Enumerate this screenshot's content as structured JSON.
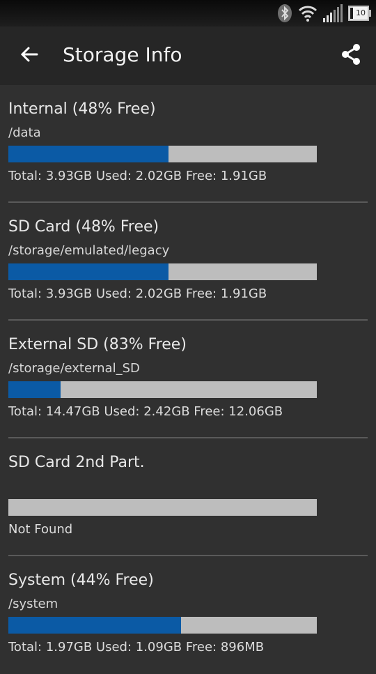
{
  "status_bar": {
    "battery_level": "10",
    "icons": [
      "bluetooth-icon",
      "wifi-icon",
      "signal-icon",
      "battery-icon"
    ]
  },
  "app_bar": {
    "title": "Storage Info",
    "back_icon": "arrow-left-icon",
    "share_icon": "share-icon"
  },
  "colors": {
    "used_fill": "#0b5aa5",
    "bar_track": "#bdbdbd",
    "background": "#303030",
    "app_bar": "#262626"
  },
  "storages": [
    {
      "name": "Internal (48% Free)",
      "path": "/data",
      "used_fraction": 0.52,
      "stats": "Total: 3.93GB Used: 2.02GB Free: 1.91GB"
    },
    {
      "name": "SD Card (48% Free)",
      "path": "/storage/emulated/legacy",
      "used_fraction": 0.52,
      "stats": "Total: 3.93GB Used: 2.02GB Free: 1.91GB"
    },
    {
      "name": "External SD (83% Free)",
      "path": "/storage/external_SD",
      "used_fraction": 0.17,
      "stats": "Total: 14.47GB Used: 2.42GB Free: 12.06GB"
    },
    {
      "name": "SD Card 2nd Part.",
      "path": "",
      "used_fraction": 0,
      "stats": "Not Found"
    },
    {
      "name": "System (44% Free)",
      "path": "/system",
      "used_fraction": 0.56,
      "stats": "Total: 1.97GB Used: 1.09GB Free: 896MB"
    }
  ]
}
